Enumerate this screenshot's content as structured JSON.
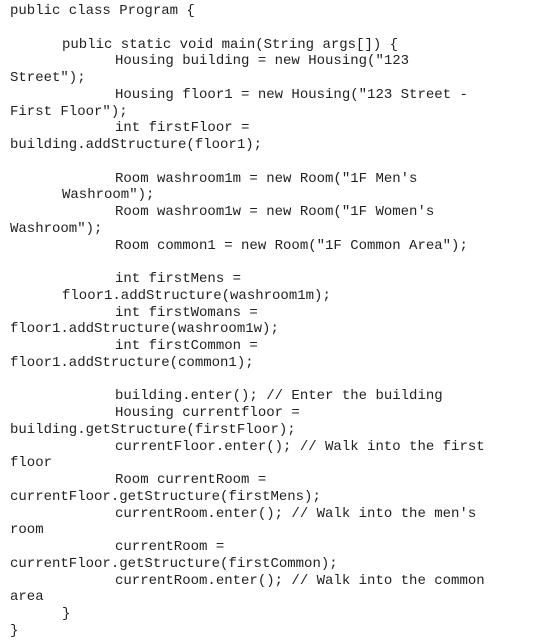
{
  "document": {
    "language": "java",
    "lines": [
      {
        "text": "public class Program {",
        "indent": 0
      },
      {
        "text": "",
        "indent": 0
      },
      {
        "text": "public static void main(String args[]) {",
        "indent": 1
      },
      {
        "text": "Housing building = new Housing(\"123",
        "indent": 2
      },
      {
        "text": "Street\");",
        "indent": 0
      },
      {
        "text": "Housing floor1 = new Housing(\"123 Street -",
        "indent": 2
      },
      {
        "text": "First Floor\");",
        "indent": 0
      },
      {
        "text": "int firstFloor =",
        "indent": 2
      },
      {
        "text": "building.addStructure(floor1);",
        "indent": 0
      },
      {
        "text": "",
        "indent": 0
      },
      {
        "text": "Room washroom1m = new Room(\"1F Men's",
        "indent": 2
      },
      {
        "text": "Washroom\");",
        "indent": 1
      },
      {
        "text": "Room washroom1w = new Room(\"1F Women's",
        "indent": 2
      },
      {
        "text": "Washroom\");",
        "indent": 0
      },
      {
        "text": "Room common1 = new Room(\"1F Common Area\");",
        "indent": 2
      },
      {
        "text": "",
        "indent": 0
      },
      {
        "text": "int firstMens =",
        "indent": 2
      },
      {
        "text": "floor1.addStructure(washroom1m);",
        "indent": 1
      },
      {
        "text": "int firstWomans =",
        "indent": 2
      },
      {
        "text": "floor1.addStructure(washroom1w);",
        "indent": 0
      },
      {
        "text": "int firstCommon =",
        "indent": 2
      },
      {
        "text": "floor1.addStructure(common1);",
        "indent": 0
      },
      {
        "text": "",
        "indent": 0
      },
      {
        "text": "building.enter(); // Enter the building",
        "indent": 2
      },
      {
        "text": "Housing currentfloor =",
        "indent": 2
      },
      {
        "text": "building.getStructure(firstFloor);",
        "indent": 0
      },
      {
        "text": "currentFloor.enter(); // Walk into the first",
        "indent": 2
      },
      {
        "text": "floor",
        "indent": 0
      },
      {
        "text": "Room currentRoom =",
        "indent": 2
      },
      {
        "text": "currentFloor.getStructure(firstMens);",
        "indent": 0
      },
      {
        "text": "currentRoom.enter(); // Walk into the men's",
        "indent": 2
      },
      {
        "text": "room",
        "indent": 0
      },
      {
        "text": "currentRoom =",
        "indent": 2
      },
      {
        "text": "currentFloor.getStructure(firstCommon);",
        "indent": 0
      },
      {
        "text": "currentRoom.enter(); // Walk into the common",
        "indent": 2
      },
      {
        "text": "area",
        "indent": 0
      },
      {
        "text": "}",
        "indent": 1
      },
      {
        "text": "}",
        "indent": 0
      }
    ]
  }
}
